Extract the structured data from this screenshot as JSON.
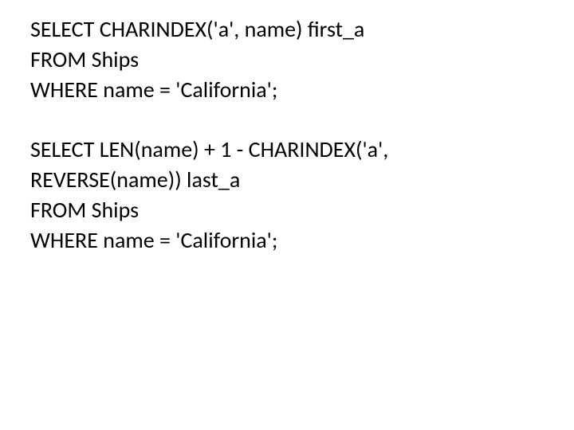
{
  "lines": {
    "l1": "SELECT CHARINDEX('a', name) first_a",
    "l2": "FROM Ships",
    "l3": "WHERE name = 'California';",
    "l4": "",
    "l5": "SELECT LEN(name) + 1 - CHARINDEX('a', REVERSE(name)) last_a",
    "l6": "FROM Ships",
    "l7": "WHERE name = 'California';"
  }
}
